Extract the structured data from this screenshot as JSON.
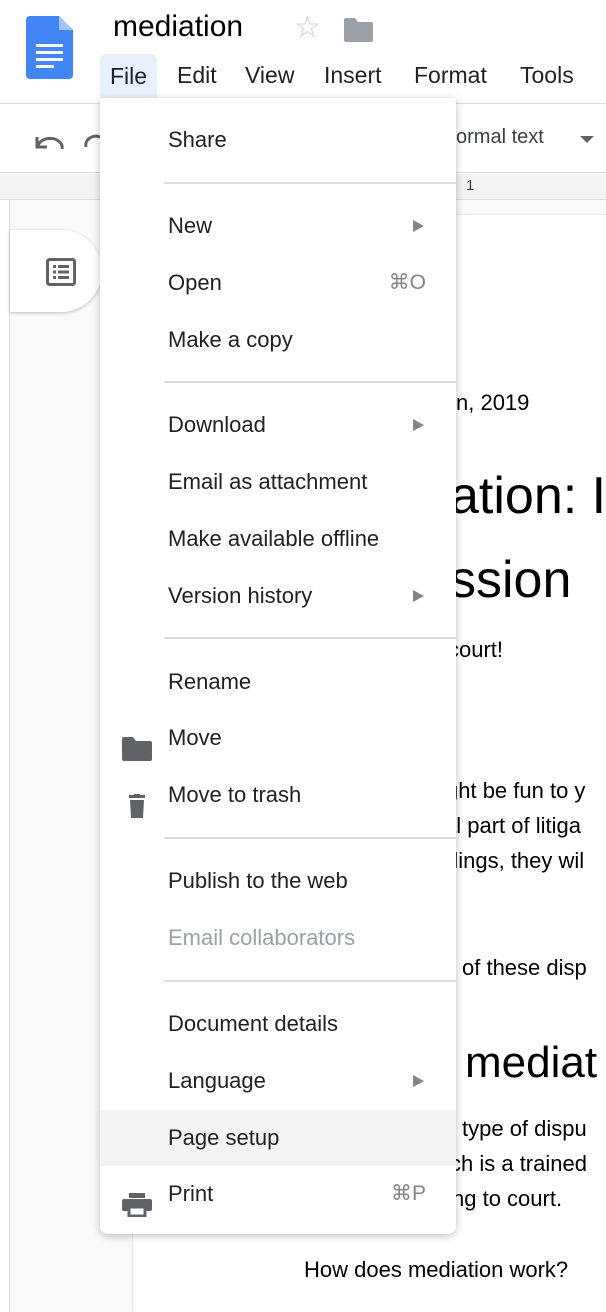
{
  "header": {
    "title": "mediation",
    "menubar": [
      "File",
      "Edit",
      "View",
      "Insert",
      "Format",
      "Tools"
    ]
  },
  "toolbar": {
    "style_value": "ormal text",
    "ruler_mark": "1"
  },
  "document": {
    "lines": [
      "n, 2019",
      "ation: I",
      "ssion",
      "court!",
      "ght be fun to y",
      "al part of litiga",
      "dings, they wil",
      "of these disp",
      "mediat",
      "type of dispu",
      "ch is a trained",
      "ng to court.",
      "How does mediation work?"
    ]
  },
  "file_menu": {
    "items": [
      {
        "label": "Share"
      },
      {
        "label": "New",
        "submenu": true
      },
      {
        "label": "Open",
        "shortcut": "⌘O"
      },
      {
        "label": "Make a copy"
      },
      {
        "label": "Download",
        "submenu": true
      },
      {
        "label": "Email as attachment"
      },
      {
        "label": "Make available offline"
      },
      {
        "label": "Version history",
        "submenu": true
      },
      {
        "label": "Rename"
      },
      {
        "label": "Move",
        "icon": "folder-icon"
      },
      {
        "label": "Move to trash",
        "icon": "trash-icon"
      },
      {
        "label": "Publish to the web"
      },
      {
        "label": "Email collaborators",
        "disabled": true
      },
      {
        "label": "Document details"
      },
      {
        "label": "Language",
        "submenu": true
      },
      {
        "label": "Page setup",
        "hovered": true
      },
      {
        "label": "Print",
        "icon": "print-icon",
        "shortcut": "⌘P"
      }
    ]
  },
  "colors": {
    "accent": "#4285f4",
    "menu_hover": "#f1f3f4",
    "active_menu": "#e8f0fe"
  }
}
